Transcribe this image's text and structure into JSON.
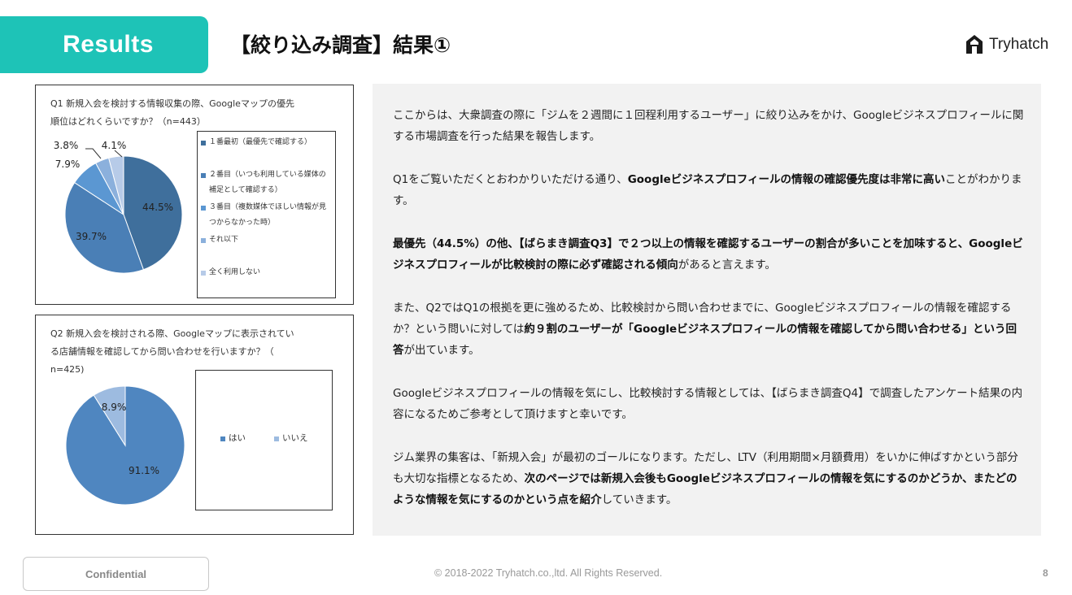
{
  "header": {
    "section_label": "Results",
    "title": "【絞り込み調査】結果①",
    "logo_text": "Tryhatch"
  },
  "colors": {
    "accent": "#1ec3b7",
    "pie_dark": "#3f6f9c",
    "pie_mid": "#4a7fb6",
    "pie_light": "#5b97d2",
    "pie_lighter": "#8bb0dc",
    "pie_lightest": "#b7cbe8"
  },
  "chart_data": [
    {
      "type": "pie",
      "title": "Q1 新規入会を検討する情報収集の際、Googleマップの優先順位はどれくらいですか？（n=443）",
      "title_lines": [
        "Q1 新規入会を検討する情報収集の際、Googleマップの優先",
        "順位はどれくらいですか？（n=443）"
      ],
      "labels": [
        "１番最初（最優先で確認する）",
        "２番目（いつも利用している媒体の補足として確認する）",
        "３番目（複数媒体でほしい情報が見つからなかった時）",
        "それ以下",
        "全く利用しない"
      ],
      "legend_lines": [
        [
          "１番最初（最優先で確認する）"
        ],
        [
          "２番目（いつも利用している媒体の",
          "補足として確認する）"
        ],
        [
          "３番目（複数媒体でほしい情報が見",
          "つからなかった時）"
        ],
        [
          "それ以下"
        ],
        [
          "全く利用しない"
        ]
      ],
      "values": [
        44.5,
        39.7,
        7.9,
        3.8,
        4.1
      ],
      "value_labels": [
        "44.5%",
        "39.7%",
        "7.9%",
        "3.8%",
        "4.1%"
      ],
      "colors": [
        "#3f6f9c",
        "#4a7fb6",
        "#5b97d2",
        "#8bb0dc",
        "#b7cbe8"
      ]
    },
    {
      "type": "pie",
      "title": "Q2 新規入会を検討される際、Googleマップに表示されている店舗情報を確認してから問い合わせを行いますか？（n=425)",
      "title_lines": [
        "Q2 新規入会を検討される際、Googleマップに表示されてい",
        "る店舗情報を確認してから問い合わせを行いますか？（",
        "n=425)"
      ],
      "labels": [
        "はい",
        "いいえ"
      ],
      "values": [
        91.1,
        8.9
      ],
      "value_labels": [
        "91.1%",
        "8.9%"
      ],
      "colors": [
        "#4f86c0",
        "#9dbbe0"
      ]
    }
  ],
  "body": {
    "paragraphs": [
      [
        {
          "t": "ここからは、大衆調査の際に「ジムを２週間に１回程利用するユーザー」に絞り込みをかけ、Googleビジネスプロフィールに関する市場調査を行った結果を報告します。",
          "b": false
        }
      ],
      [
        {
          "t": "Q1をご覧いただくとおわかりいただける通り、",
          "b": false
        },
        {
          "t": "Googleビジネスプロフィールの情報の確認優先度は非常に高い",
          "b": true
        },
        {
          "t": "ことがわかります。",
          "b": false
        }
      ],
      [
        {
          "t": "最優先（44.5%）の他、【ばらまき調査Q3】で２つ以上の情報を確認するユーザーの割合が多いことを加味すると、Googleビジネスプロフィールが比較検討の際に必ず確認される傾向",
          "b": true
        },
        {
          "t": "があると言えます。",
          "b": false
        }
      ],
      [
        {
          "t": "また、Q2ではQ1の根拠を更に強めるため、比較検討から問い合わせまでに、Googleビジネスプロフィールの情報を確認するか？という問いに対しては",
          "b": false
        },
        {
          "t": "約９割のユーザーが「Googleビジネスプロフィールの情報を確認してから問い合わせる」という回答",
          "b": true
        },
        {
          "t": "が出ています。",
          "b": false
        }
      ],
      [
        {
          "t": "Googleビジネスプロフィールの情報を気にし、比較検討する情報としては、【ばらまき調査Q4】で調査したアンケート結果の内容になるためご参考として頂けますと幸いです。",
          "b": false
        }
      ],
      [
        {
          "t": "ジム業界の集客は、「新規入会」が最初のゴールになります。ただし、LTV（利用期間×月額費用）をいかに伸ばすかという部分も大切な指標となるため、",
          "b": false
        },
        {
          "t": "次のページでは新規入会後もGoogleビジネスプロフィールの情報を気にするのかどうか、またどのような情報を気にするのかという点を紹介",
          "b": true
        },
        {
          "t": "していきます。",
          "b": false
        }
      ]
    ]
  },
  "footer": {
    "confidential": "Confidential",
    "copyright": "© 2018-2022 Tryhatch.co.,ltd. All Rights Reserved.",
    "page_number": "8"
  }
}
